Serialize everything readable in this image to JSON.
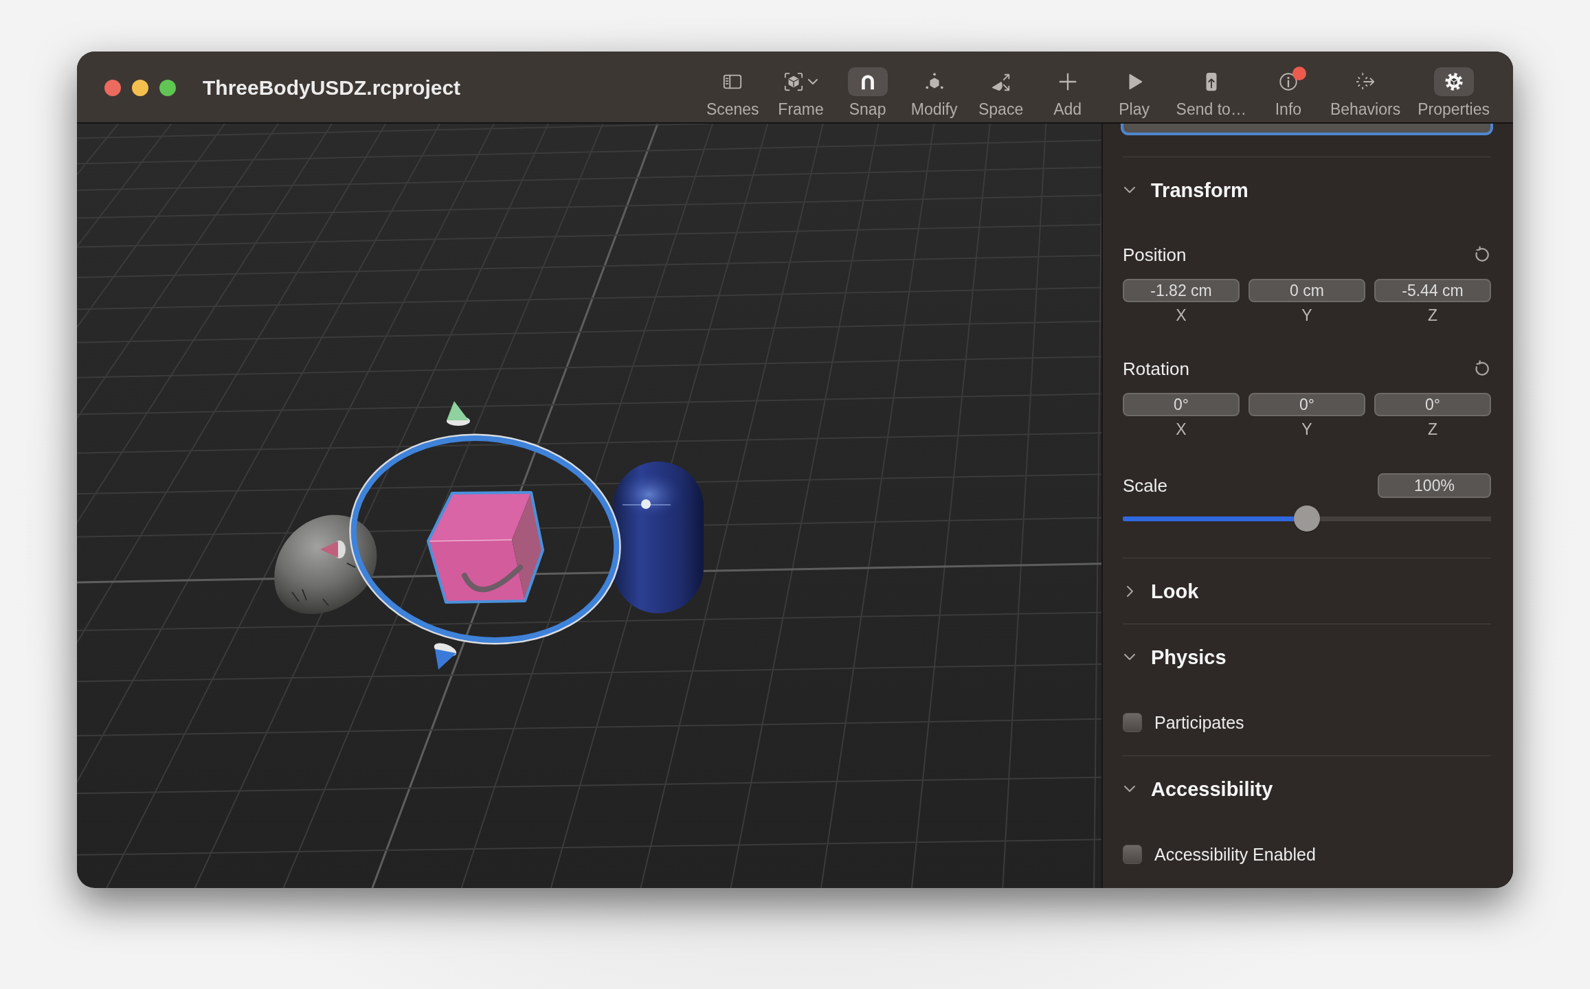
{
  "window": {
    "title": "ThreeBodyUSDZ.rcproject"
  },
  "toolbar": [
    {
      "label": "Scenes",
      "kind": "scenes",
      "active": false,
      "dropdown": false,
      "badge": false
    },
    {
      "label": "Frame",
      "kind": "frame",
      "active": false,
      "dropdown": true,
      "badge": false
    },
    {
      "label": "Snap",
      "kind": "snap",
      "active": true,
      "dropdown": false,
      "badge": false
    },
    {
      "label": "Modify",
      "kind": "modify",
      "active": false,
      "dropdown": false,
      "badge": false
    },
    {
      "label": "Space",
      "kind": "space",
      "active": false,
      "dropdown": false,
      "badge": false
    },
    {
      "label": "Add",
      "kind": "add",
      "active": false,
      "dropdown": false,
      "badge": false
    },
    {
      "label": "Play",
      "kind": "play",
      "active": false,
      "dropdown": false,
      "badge": false
    },
    {
      "label": "Send to…",
      "kind": "send",
      "active": false,
      "dropdown": false,
      "badge": false
    },
    {
      "label": "Info",
      "kind": "info",
      "active": false,
      "dropdown": false,
      "badge": true
    },
    {
      "label": "Behaviors",
      "kind": "behaviors",
      "active": false,
      "dropdown": false,
      "badge": false
    },
    {
      "label": "Properties",
      "kind": "properties",
      "active": true,
      "dropdown": false,
      "badge": false
    }
  ],
  "inspector": {
    "name_field": {
      "focused": true
    },
    "sections": [
      {
        "kind": "transform",
        "title": "Transform",
        "expanded": true,
        "vectors": [
          {
            "label": "Position",
            "fields": [
              {
                "value": "-1.82 cm",
                "axis": "X"
              },
              {
                "value": "0 cm",
                "axis": "Y"
              },
              {
                "value": "-5.44 cm",
                "axis": "Z"
              }
            ]
          },
          {
            "label": "Rotation",
            "fields": [
              {
                "value": "0°",
                "axis": "X"
              },
              {
                "value": "0°",
                "axis": "Y"
              },
              {
                "value": "0°",
                "axis": "Z"
              }
            ]
          }
        ],
        "scale": {
          "label": "Scale",
          "value": "100%",
          "level": 0.5
        }
      },
      {
        "title": "Look",
        "expanded": false
      },
      {
        "kind": "checkbox",
        "title": "Physics",
        "expanded": true,
        "option": {
          "label": "Participates",
          "checked": false
        }
      },
      {
        "kind": "checkbox",
        "title": "Accessibility",
        "expanded": true,
        "option": {
          "label": "Accessibility Enabled",
          "checked": false
        }
      }
    ]
  }
}
